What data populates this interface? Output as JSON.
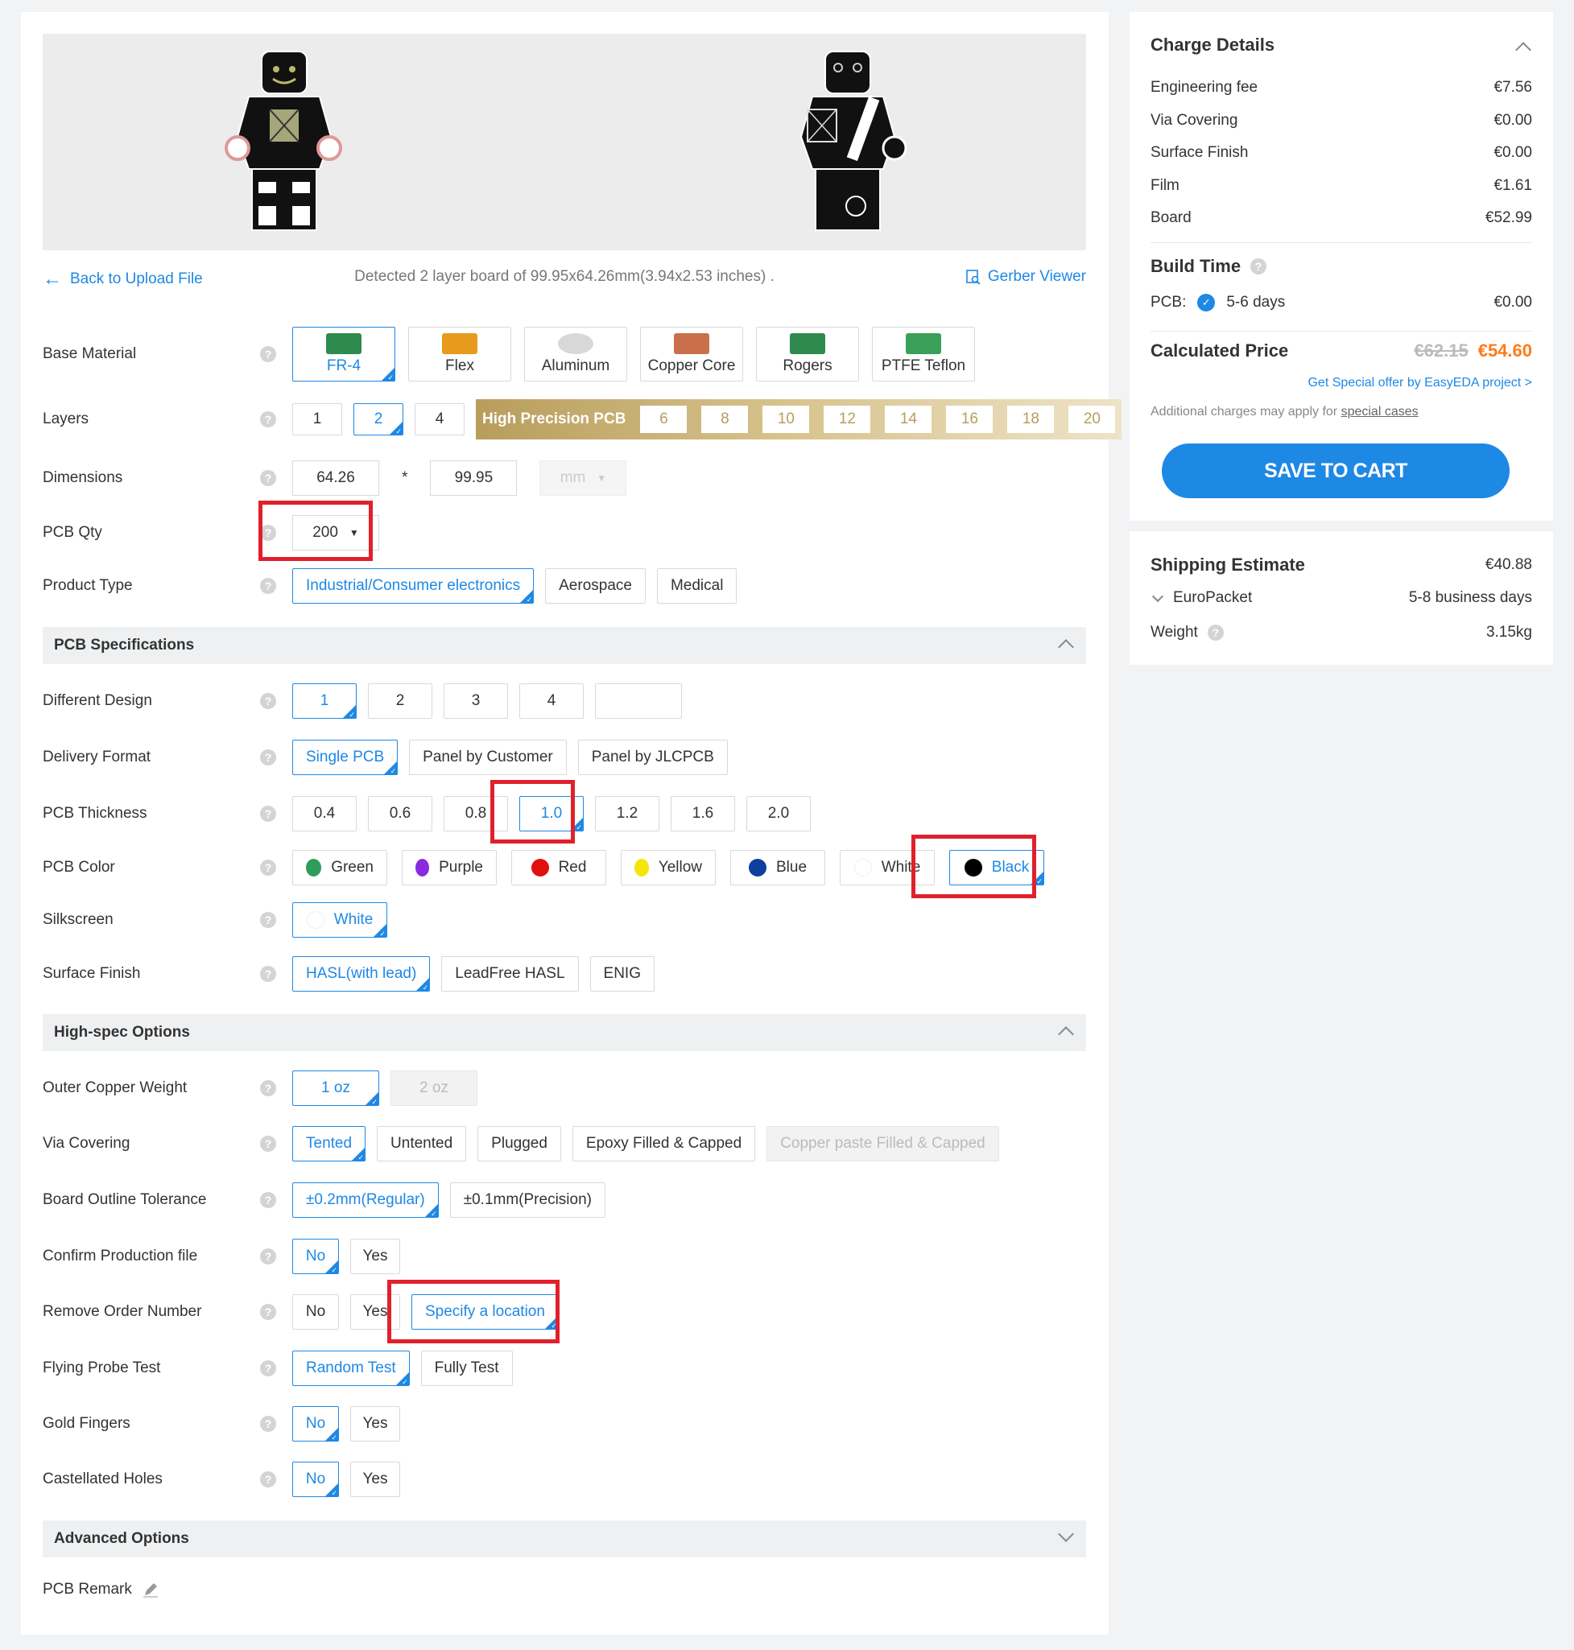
{
  "colors": {
    "accent": "#1e88e5",
    "price_orange": "#ff7a1a",
    "highlight_red": "#e0212c",
    "gold": "#b89d5c"
  },
  "nav": {
    "back": "Back to Upload File",
    "detected": "Detected 2 layer board of 99.95x64.26mm(3.94x2.53 inches) .",
    "gerber": "Gerber Viewer"
  },
  "form": {
    "base_material": {
      "label": "Base Material",
      "options": [
        "FR-4",
        "Flex",
        "Aluminum",
        "Copper Core",
        "Rogers",
        "PTFE Teflon"
      ]
    },
    "layers": {
      "label": "Layers",
      "options": [
        "1",
        "2",
        "4"
      ],
      "hp_label": "High Precision PCB",
      "hp_options": [
        "6",
        "8",
        "10",
        "12",
        "14",
        "16",
        "18",
        "20"
      ]
    },
    "dimensions": {
      "label": "Dimensions",
      "width": "64.26",
      "sep": "*",
      "height": "99.95",
      "unit": "mm"
    },
    "qty": {
      "label": "PCB Qty",
      "value": "200"
    },
    "product_type": {
      "label": "Product Type",
      "options": [
        "Industrial/Consumer electronics",
        "Aerospace",
        "Medical"
      ]
    },
    "spec_title": "PCB Specifications",
    "different_design": {
      "label": "Different Design",
      "options": [
        "1",
        "2",
        "3",
        "4"
      ]
    },
    "delivery_format": {
      "label": "Delivery Format",
      "options": [
        "Single PCB",
        "Panel by Customer",
        "Panel by JLCPCB"
      ]
    },
    "thickness": {
      "label": "PCB Thickness",
      "options": [
        "0.4",
        "0.6",
        "0.8",
        "1.0",
        "1.2",
        "1.6",
        "2.0"
      ]
    },
    "color": {
      "label": "PCB Color",
      "options": [
        {
          "name": "Green",
          "hex": "#2e9d5b"
        },
        {
          "name": "Purple",
          "hex": "#8a2be2"
        },
        {
          "name": "Red",
          "hex": "#e01010"
        },
        {
          "name": "Yellow",
          "hex": "#f5e60a"
        },
        {
          "name": "Blue",
          "hex": "#0d3f9e"
        },
        {
          "name": "White",
          "hex": "#ffffff"
        },
        {
          "name": "Black",
          "hex": "#000000"
        }
      ]
    },
    "silkscreen": {
      "label": "Silkscreen",
      "value": "White"
    },
    "surface_finish": {
      "label": "Surface Finish",
      "options": [
        "HASL(with lead)",
        "LeadFree HASL",
        "ENIG"
      ]
    },
    "high_spec_title": "High-spec Options",
    "copper_weight": {
      "label": "Outer Copper Weight",
      "options": [
        "1 oz",
        "2 oz"
      ]
    },
    "via_covering": {
      "label": "Via Covering",
      "options": [
        "Tented",
        "Untented",
        "Plugged",
        "Epoxy Filled & Capped",
        "Copper paste Filled & Capped"
      ]
    },
    "outline_tolerance": {
      "label": "Board Outline Tolerance",
      "options": [
        "±0.2mm(Regular)",
        "±0.1mm(Precision)"
      ]
    },
    "confirm_file": {
      "label": "Confirm Production file",
      "options": [
        "No",
        "Yes"
      ]
    },
    "remove_order": {
      "label": "Remove Order Number",
      "options": [
        "No",
        "Yes",
        "Specify a location"
      ]
    },
    "flying_probe": {
      "label": "Flying Probe Test",
      "options": [
        "Random Test",
        "Fully Test"
      ]
    },
    "gold_fingers": {
      "label": "Gold Fingers",
      "options": [
        "No",
        "Yes"
      ]
    },
    "castellated": {
      "label": "Castellated Holes",
      "options": [
        "No",
        "Yes"
      ]
    },
    "advanced_title": "Advanced Options",
    "remark_label": "PCB Remark"
  },
  "charges": {
    "title": "Charge Details",
    "items": [
      {
        "name": "Engineering fee",
        "value": "€7.56"
      },
      {
        "name": "Via Covering",
        "value": "€0.00"
      },
      {
        "name": "Surface Finish",
        "value": "€0.00"
      },
      {
        "name": "Film",
        "value": "€1.61"
      },
      {
        "name": "Board",
        "value": "€52.99"
      }
    ],
    "build_time_title": "Build Time",
    "pcb_label": "PCB:",
    "build_days": "5-6 days",
    "build_price": "€0.00",
    "calc_label": "Calculated Price",
    "old_price": "€62.15",
    "new_price": "€54.60",
    "special_offer": "Get Special offer by EasyEDA project >",
    "additional": "Additional charges may apply for",
    "special_cases": "special cases",
    "cart": "SAVE TO CART"
  },
  "shipping": {
    "title": "Shipping Estimate",
    "price": "€40.88",
    "method": "EuroPacket",
    "days": "5-8 business days",
    "weight_label": "Weight",
    "weight": "3.15kg"
  }
}
